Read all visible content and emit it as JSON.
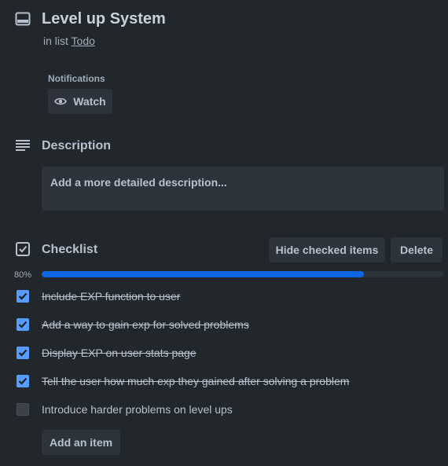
{
  "card": {
    "title": "Level up System",
    "in_list_prefix": "in list",
    "list_name": "Todo",
    "icon": "card-icon"
  },
  "notifications": {
    "label": "Notifications",
    "watch_label": "Watch",
    "icon": "eye-icon"
  },
  "description": {
    "heading": "Description",
    "placeholder": "Add a more detailed description...",
    "icon": "description-lines-icon"
  },
  "checklist": {
    "heading": "Checklist",
    "hide_checked_label": "Hide checked items",
    "delete_label": "Delete",
    "progress_label": "80%",
    "progress_value": 0.8,
    "add_item_label": "Add an item",
    "accent_color": "#0c66e4",
    "items": [
      {
        "text": "Include EXP function to user",
        "checked": true
      },
      {
        "text": "Add a way to gain exp for solved problems",
        "checked": true
      },
      {
        "text": "Display EXP on user stats page",
        "checked": true
      },
      {
        "text": "Tell the user how much exp they gained after solving a problem",
        "checked": true
      },
      {
        "text": "Introduce harder problems on level ups",
        "checked": false
      }
    ]
  }
}
